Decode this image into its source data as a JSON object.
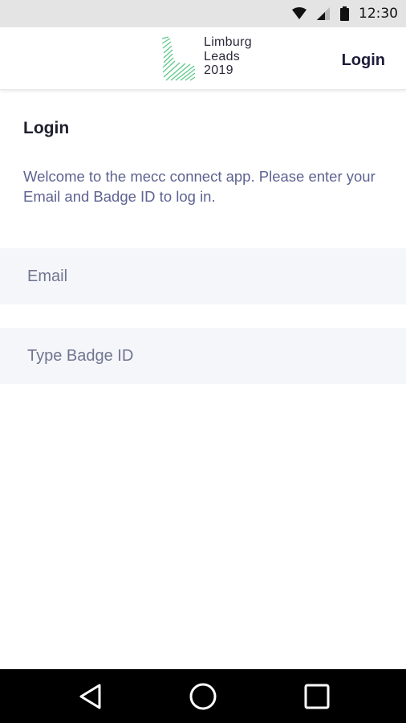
{
  "status_bar": {
    "time": "12:30",
    "icons": [
      "wifi-icon",
      "signal-icon",
      "battery-icon"
    ]
  },
  "header": {
    "brand_lines": [
      "Limburg",
      "Leads",
      "2019"
    ],
    "login_label": "Login",
    "logo_icon": "limburg-leads-logo"
  },
  "main": {
    "title": "Login",
    "intro": "Welcome to the mecc connect app. Please enter your Email and Badge ID to log in.",
    "email_placeholder": "Email",
    "badge_placeholder": "Type Badge ID"
  },
  "nav_bar": {
    "icons": [
      "back-icon",
      "home-icon",
      "recents-icon"
    ]
  },
  "colors": {
    "accent_green": "#5fc98a",
    "text_purple": "#5e6391",
    "field_bg": "#f4f6fa",
    "status_bg": "#e4e4e4"
  }
}
